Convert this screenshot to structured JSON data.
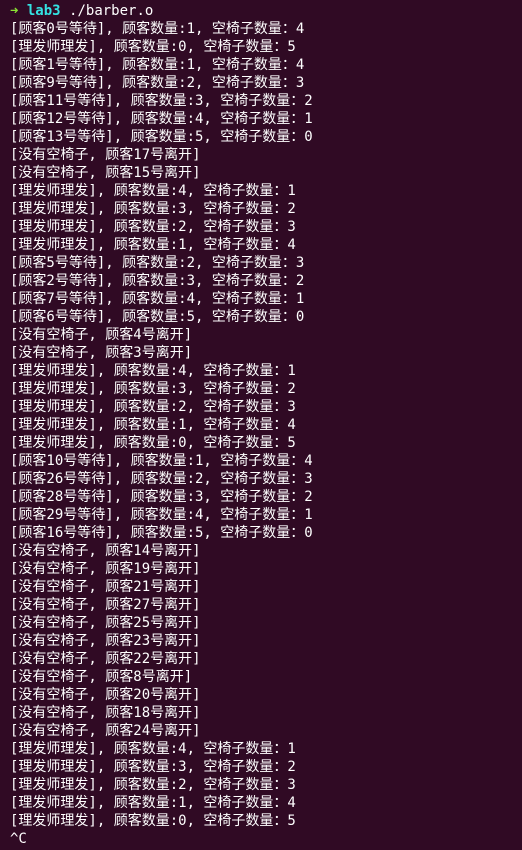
{
  "prompt": {
    "arrow": "➜",
    "dir": "lab3",
    "command": "./barber.o"
  },
  "lines": [
    "[顾客0号等待], 顾客数量:1, 空椅子数量：4",
    "[理发师理发], 顾客数量:0, 空椅子数量：5",
    "[顾客1号等待], 顾客数量:1, 空椅子数量：4",
    "[顾客9号等待], 顾客数量:2, 空椅子数量：3",
    "[顾客11号等待], 顾客数量:3, 空椅子数量：2",
    "[顾客12号等待], 顾客数量:4, 空椅子数量：1",
    "[顾客13号等待], 顾客数量:5, 空椅子数量：0",
    "[没有空椅子, 顾客17号离开]",
    "[没有空椅子, 顾客15号离开]",
    "[理发师理发], 顾客数量:4, 空椅子数量：1",
    "[理发师理发], 顾客数量:3, 空椅子数量：2",
    "[理发师理发], 顾客数量:2, 空椅子数量：3",
    "[理发师理发], 顾客数量:1, 空椅子数量：4",
    "[顾客5号等待], 顾客数量:2, 空椅子数量：3",
    "[顾客2号等待], 顾客数量:3, 空椅子数量：2",
    "[顾客7号等待], 顾客数量:4, 空椅子数量：1",
    "[顾客6号等待], 顾客数量:5, 空椅子数量：0",
    "[没有空椅子, 顾客4号离开]",
    "[没有空椅子, 顾客3号离开]",
    "[理发师理发], 顾客数量:4, 空椅子数量：1",
    "[理发师理发], 顾客数量:3, 空椅子数量：2",
    "[理发师理发], 顾客数量:2, 空椅子数量：3",
    "[理发师理发], 顾客数量:1, 空椅子数量：4",
    "[理发师理发], 顾客数量:0, 空椅子数量：5",
    "[顾客10号等待], 顾客数量:1, 空椅子数量：4",
    "[顾客26号等待], 顾客数量:2, 空椅子数量：3",
    "[顾客28号等待], 顾客数量:3, 空椅子数量：2",
    "[顾客29号等待], 顾客数量:4, 空椅子数量：1",
    "[顾客16号等待], 顾客数量:5, 空椅子数量：0",
    "[没有空椅子, 顾客14号离开]",
    "[没有空椅子, 顾客19号离开]",
    "[没有空椅子, 顾客21号离开]",
    "[没有空椅子, 顾客27号离开]",
    "[没有空椅子, 顾客25号离开]",
    "[没有空椅子, 顾客23号离开]",
    "[没有空椅子, 顾客22号离开]",
    "[没有空椅子, 顾客8号离开]",
    "[没有空椅子, 顾客20号离开]",
    "[没有空椅子, 顾客18号离开]",
    "[没有空椅子, 顾客24号离开]",
    "[理发师理发], 顾客数量:4, 空椅子数量：1",
    "[理发师理发], 顾客数量:3, 空椅子数量：2",
    "[理发师理发], 顾客数量:2, 空椅子数量：3",
    "[理发师理发], 顾客数量:1, 空椅子数量：4",
    "[理发师理发], 顾客数量:0, 空椅子数量：5",
    "^C"
  ],
  "colors": {
    "background": "#300a24",
    "text": "#ffffff",
    "prompt_arrow": "#8ae234",
    "prompt_dir": "#34e2e2"
  }
}
